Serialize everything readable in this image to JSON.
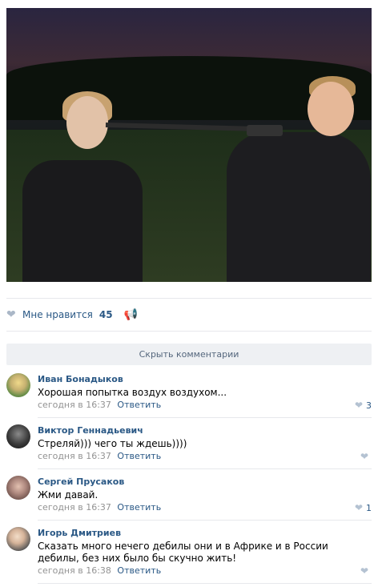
{
  "post": {
    "photo_alt": "photo",
    "likes_label": "Мне нравится",
    "likes_count": "45"
  },
  "comments_block": {
    "hide_label": "Скрыть комментарии",
    "items": [
      {
        "author": "Иван Бонадыков",
        "text": "Хорошая попытка воздух воздухом...",
        "time": "сегодня в 16:37",
        "reply": "Ответить",
        "likes": "3"
      },
      {
        "author": "Виктор Геннадьевич",
        "text": "Стреляй))) чего ты ждешь))))",
        "time": "сегодня в 16:37",
        "reply": "Ответить",
        "likes": ""
      },
      {
        "author": "Сергей Прусаков",
        "text": "Жми давай.",
        "time": "сегодня в 16:37",
        "reply": "Ответить",
        "likes": "1"
      },
      {
        "author": "Игорь Дмитриев",
        "text": "Сказать много нечего дебилы они и в Африке и в России дебилы, без них было бы скучно жить!",
        "time": "сегодня в 16:38",
        "reply": "Ответить",
        "likes": ""
      }
    ]
  },
  "icons": {
    "like": "heart-icon",
    "share": "megaphone-icon"
  },
  "colors": {
    "link": "#2a5885",
    "meta": "#939393",
    "button_bg": "#eef0f3",
    "divider": "#e7e8ec"
  }
}
